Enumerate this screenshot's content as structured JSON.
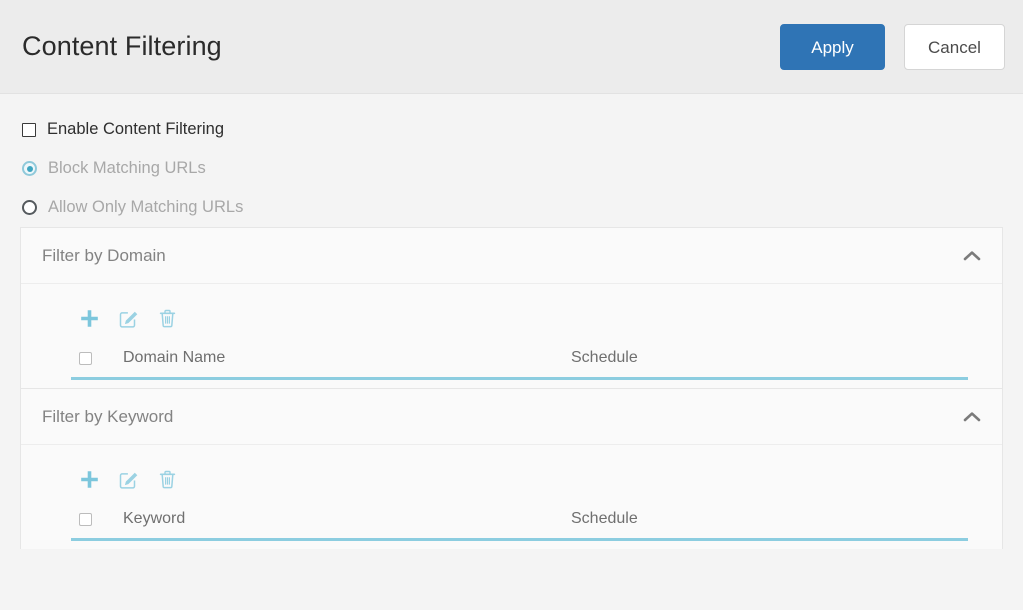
{
  "header": {
    "title": "Content Filtering",
    "apply_label": "Apply",
    "cancel_label": "Cancel"
  },
  "options": {
    "enable": {
      "label": "Enable Content Filtering",
      "checked": false
    },
    "mode": {
      "block": "Block Matching URLs",
      "allow": "Allow Only Matching URLs",
      "selected": "Block Matching URLs"
    }
  },
  "panels": [
    {
      "title": "Filter by Domain",
      "collapse_icon": "chevron-up-icon",
      "toolbar": [
        {
          "name": "add-icon",
          "label": "+"
        },
        {
          "name": "edit-icon",
          "label": "Edit"
        },
        {
          "name": "delete-icon",
          "label": "Delete"
        }
      ],
      "columns": [
        "Domain Name",
        "Schedule"
      ],
      "rows": []
    },
    {
      "title": "Filter by Keyword",
      "collapse_icon": "chevron-up-icon",
      "toolbar": [
        {
          "name": "add-icon",
          "label": "+"
        },
        {
          "name": "edit-icon",
          "label": "Edit"
        },
        {
          "name": "delete-icon",
          "label": "Delete"
        }
      ],
      "columns": [
        "Keyword",
        "Schedule"
      ],
      "rows": []
    }
  ],
  "colors": {
    "primary_button": "#2f74b5",
    "accent_teal": "#8ccde0",
    "icon_teal": "#8dcfe2",
    "header_bg": "#ececec",
    "page_bg": "#f4f4f4"
  }
}
